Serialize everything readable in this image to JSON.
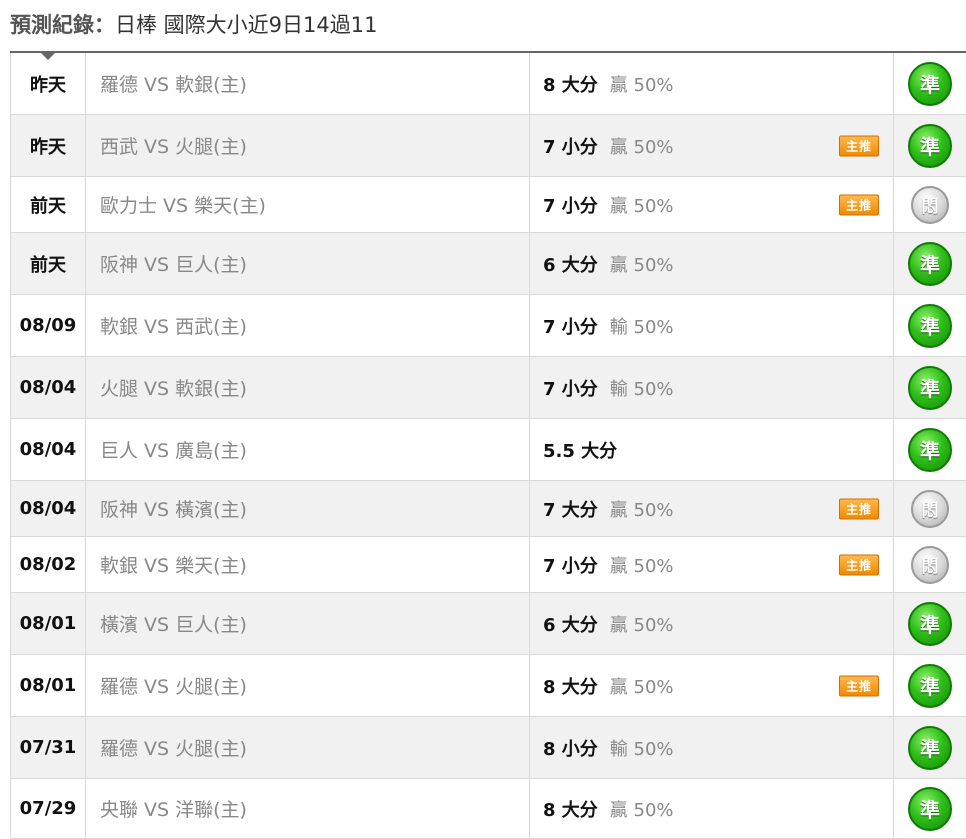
{
  "header": {
    "label": "預測紀錄：",
    "subtitle": "日棒 國際大小近9日14過11"
  },
  "rows": [
    {
      "date": "昨天",
      "match": "羅德 VS 軟銀(主)",
      "pick": "8 大分",
      "odds": "贏 50%",
      "tag": "",
      "result": "準",
      "status": "win"
    },
    {
      "date": "昨天",
      "match": "西武 VS 火腿(主)",
      "pick": "7 小分",
      "odds": "贏 50%",
      "tag": "主推",
      "result": "準",
      "status": "win"
    },
    {
      "date": "前天",
      "match": "歐力士 VS 樂天(主)",
      "pick": "7 小分",
      "odds": "贏 50%",
      "tag": "主推",
      "result": "悶",
      "status": "miss"
    },
    {
      "date": "前天",
      "match": "阪神 VS 巨人(主)",
      "pick": "6 大分",
      "odds": "贏 50%",
      "tag": "",
      "result": "準",
      "status": "win"
    },
    {
      "date": "08/09",
      "match": "軟銀 VS 西武(主)",
      "pick": "7 小分",
      "odds": "輸 50%",
      "tag": "",
      "result": "準",
      "status": "win"
    },
    {
      "date": "08/04",
      "match": "火腿 VS 軟銀(主)",
      "pick": "7 小分",
      "odds": "輸 50%",
      "tag": "",
      "result": "準",
      "status": "win"
    },
    {
      "date": "08/04",
      "match": "巨人 VS 廣島(主)",
      "pick": "5.5 大分",
      "odds": "",
      "tag": "",
      "result": "準",
      "status": "win"
    },
    {
      "date": "08/04",
      "match": "阪神 VS 橫濱(主)",
      "pick": "7 大分",
      "odds": "贏 50%",
      "tag": "主推",
      "result": "悶",
      "status": "miss"
    },
    {
      "date": "08/02",
      "match": "軟銀 VS 樂天(主)",
      "pick": "7 小分",
      "odds": "贏 50%",
      "tag": "主推",
      "result": "悶",
      "status": "miss"
    },
    {
      "date": "08/01",
      "match": "橫濱 VS 巨人(主)",
      "pick": "6 大分",
      "odds": "贏 50%",
      "tag": "",
      "result": "準",
      "status": "win"
    },
    {
      "date": "08/01",
      "match": "羅德 VS 火腿(主)",
      "pick": "8 大分",
      "odds": "贏 50%",
      "tag": "主推",
      "result": "準",
      "status": "win"
    },
    {
      "date": "07/31",
      "match": "羅德 VS 火腿(主)",
      "pick": "8 小分",
      "odds": "輸 50%",
      "tag": "",
      "result": "準",
      "status": "win"
    },
    {
      "date": "07/29",
      "match": "央聯 VS 洋聯(主)",
      "pick": "8 大分",
      "odds": "贏 50%",
      "tag": "",
      "result": "準",
      "status": "win"
    }
  ],
  "colors": {
    "win": "#2fbf1a",
    "miss": "#bdbdbd",
    "tag": "#f08a00",
    "rule": "#666666"
  },
  "icons": {
    "win": "green-check-badge-icon",
    "miss": "grey-badge-icon"
  }
}
